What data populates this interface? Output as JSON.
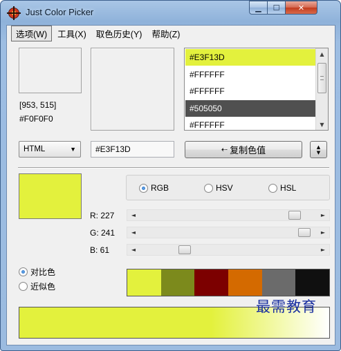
{
  "window": {
    "title": "Just Color Picker"
  },
  "menu": [
    "选项(W)",
    "工具(X)",
    "取色历史(Y)",
    "帮助(Z)"
  ],
  "picker": {
    "coords": "[953, 515]",
    "color_hex": "#F0F0F0"
  },
  "history": [
    {
      "hex": "#E3F13D",
      "state": "selected-current"
    },
    {
      "hex": "#FFFFFF",
      "state": "normal"
    },
    {
      "hex": "#FFFFFF",
      "state": "normal"
    },
    {
      "hex": "#505050",
      "state": "highlight"
    },
    {
      "hex": "#FFFFFF",
      "state": "normal"
    }
  ],
  "format_select": {
    "value": "HTML"
  },
  "hex_input": {
    "value": "#E3F13D"
  },
  "copy_button": {
    "label": "复制色值"
  },
  "current_color": "#e3f13d",
  "modes": [
    {
      "label": "RGB",
      "selected": true
    },
    {
      "label": "HSV",
      "selected": false
    },
    {
      "label": "HSL",
      "selected": false
    }
  ],
  "sliders": [
    {
      "label": "R: 227",
      "channel": "R",
      "value": 227,
      "max": 255
    },
    {
      "label": "G: 241",
      "channel": "G",
      "value": 241,
      "max": 255
    },
    {
      "label": "B: 61",
      "channel": "B",
      "value": 61,
      "max": 255
    }
  ],
  "scheme": [
    {
      "label": "对比色",
      "selected": true
    },
    {
      "label": "近似色",
      "selected": false
    }
  ],
  "palette": [
    "#e3f13d",
    "#7c8a1c",
    "#7c0000",
    "#d46a00",
    "#6b6b6b",
    "#101010"
  ],
  "gradient": {
    "from": "#e3f13d",
    "to": "#ffffff"
  },
  "watermark": "最需教育"
}
